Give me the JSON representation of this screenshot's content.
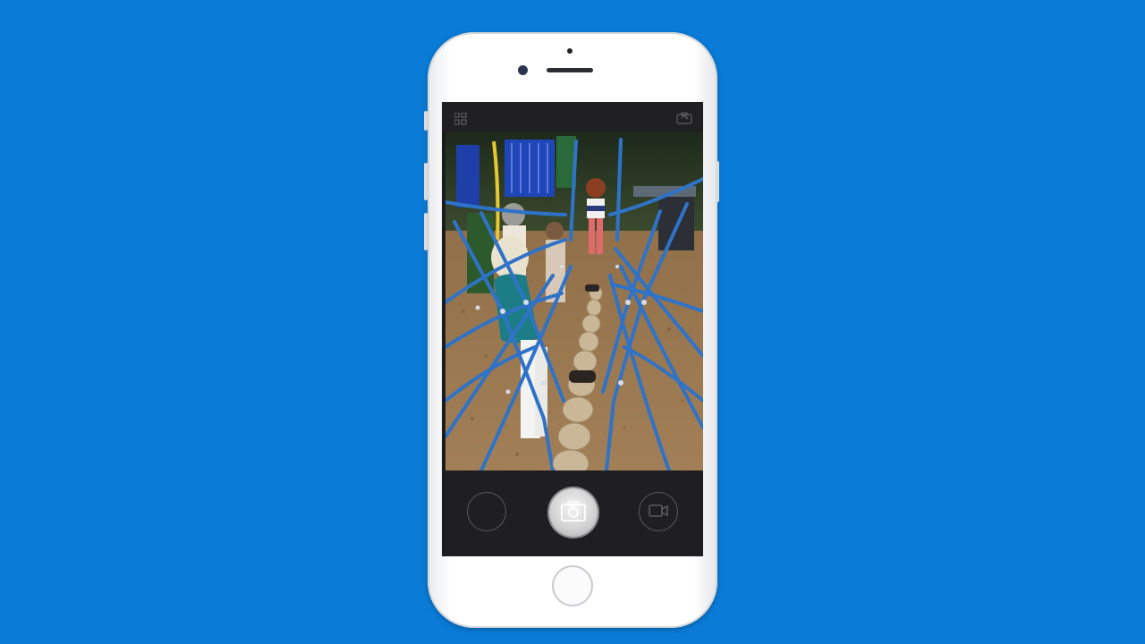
{
  "background_color": "#0a7bd6",
  "device": {
    "body_color": "#ffffff",
    "screen_bg": "#1c1c1e"
  },
  "camera_app": {
    "top_bar": {
      "left_icon": "grid-icon",
      "right_icon": "switch-camera-icon"
    },
    "viewfinder": {
      "scene": "playground-rope-bridge"
    },
    "controls": {
      "left_icon": "empty-circle-icon",
      "center_icon": "photo-camera-icon",
      "right_icon": "video-camera-icon"
    }
  }
}
